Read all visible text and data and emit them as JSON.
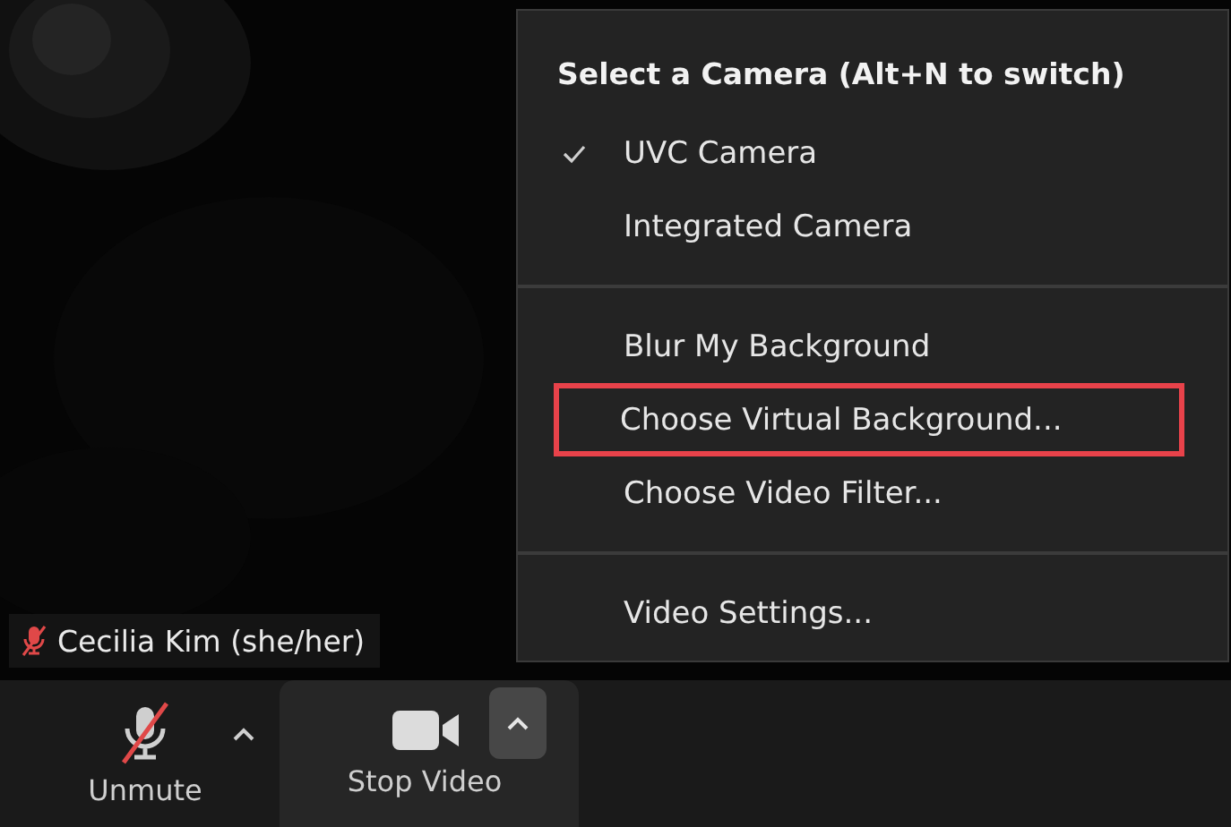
{
  "video": {
    "kind": "picture",
    "name_tag": {
      "name": "Cecilia Kim (she/her)",
      "muted": true
    }
  },
  "camera_menu": {
    "title": "Select a Camera (Alt+N to switch)",
    "sections": [
      {
        "items": [
          {
            "label": "UVC Camera",
            "checked": true,
            "highlighted": false
          },
          {
            "label": "Integrated Camera",
            "checked": false,
            "highlighted": false
          }
        ]
      },
      {
        "items": [
          {
            "label": "Blur My Background",
            "highlighted": false
          },
          {
            "label": "Choose Virtual Background...",
            "highlighted": true
          },
          {
            "label": "Choose Video Filter...",
            "highlighted": false
          }
        ]
      },
      {
        "items": [
          {
            "label": "Video Settings...",
            "highlighted": false
          }
        ]
      }
    ]
  },
  "toolbar": {
    "audio": {
      "label": "Unmute",
      "muted": true
    },
    "video": {
      "label": "Stop Video",
      "menu_open": true
    }
  }
}
